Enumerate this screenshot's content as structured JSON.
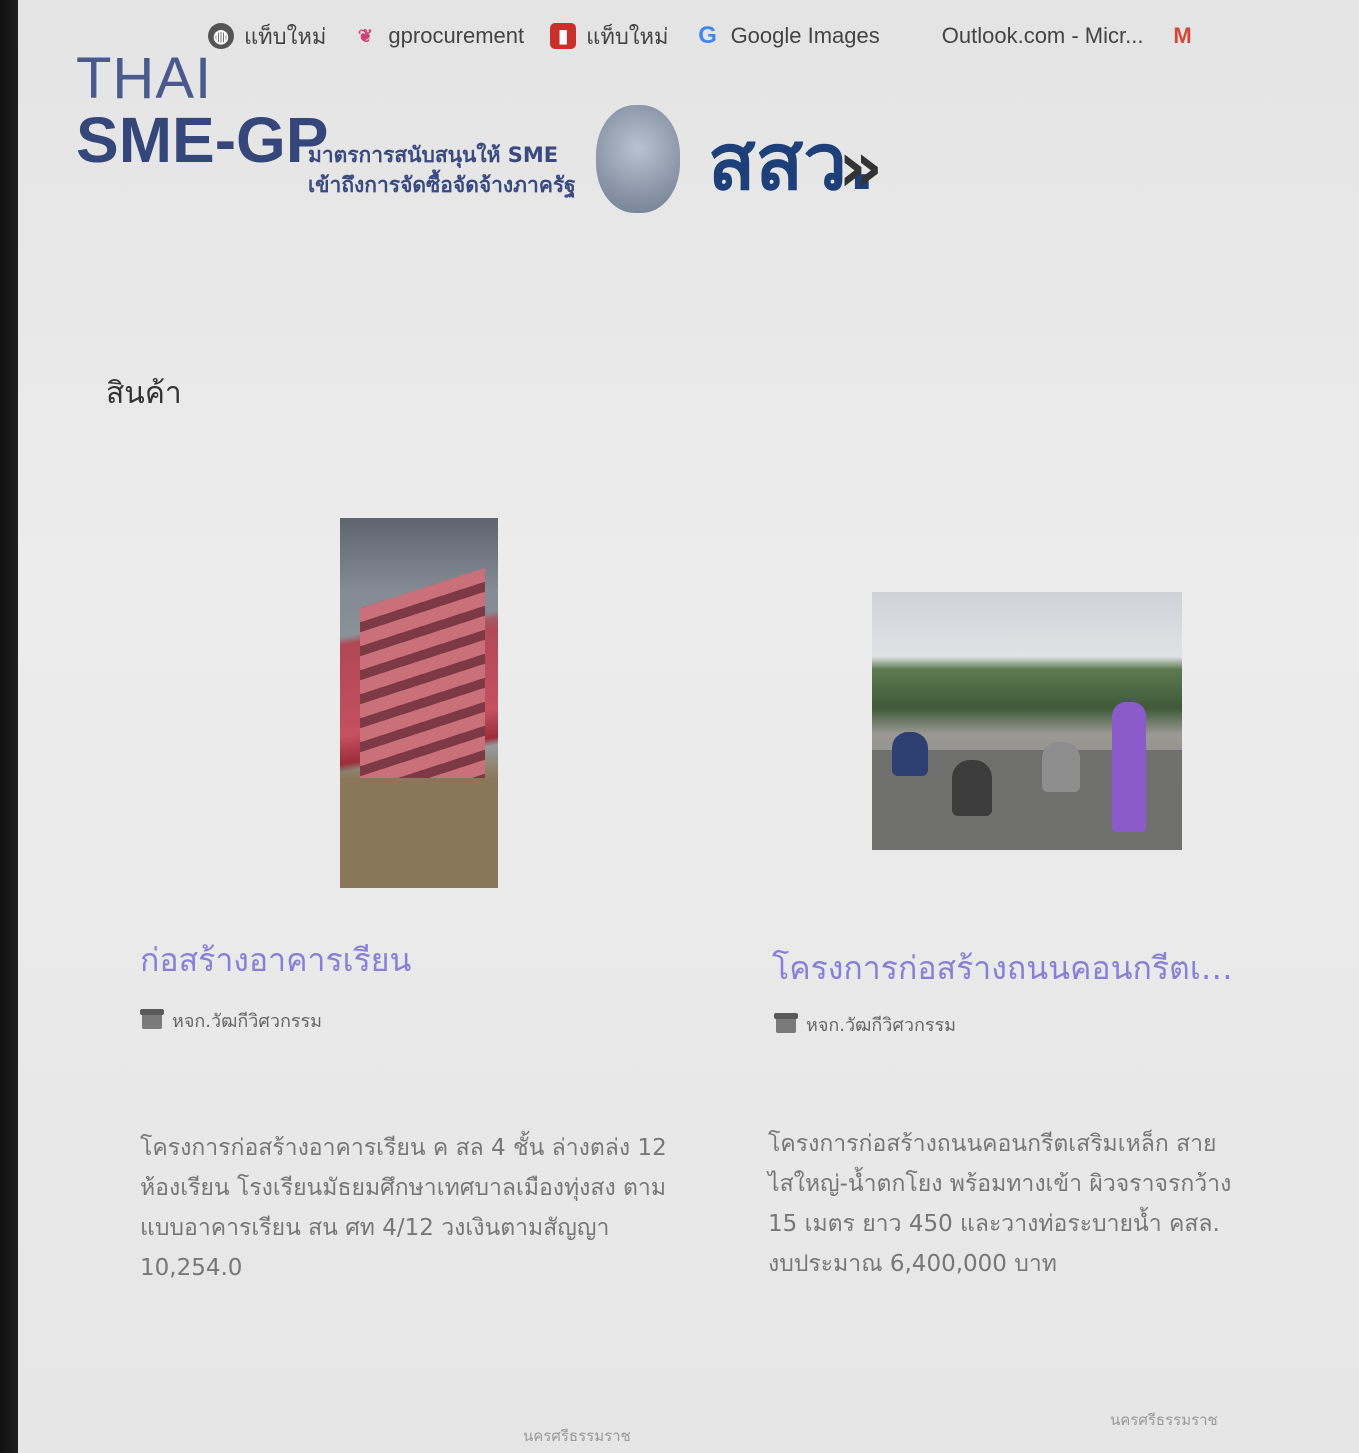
{
  "bookmarks": [
    {
      "label": "แท็บใหม่",
      "icon": "globe-icon"
    },
    {
      "label": "gprocurement",
      "icon": "gprocurement-icon"
    },
    {
      "label": "แท็บใหม่",
      "icon": "tab-icon"
    },
    {
      "label": "Google Images",
      "icon": "google-icon"
    },
    {
      "label": "Outlook.com - Micr...",
      "icon": "microsoft-icon"
    },
    {
      "label": "",
      "icon": "gmail-icon"
    }
  ],
  "header": {
    "logo_line1": "THAI",
    "logo_line2": "SME-GP",
    "tagline_line1": "มาตรการสนับสนุนให้ SME",
    "tagline_line2": "เข้าถึงการจัดซื้อจัดจ้างภาครัฐ",
    "agency_logo": "สสว."
  },
  "section": {
    "title": "สินค้า"
  },
  "products": [
    {
      "title": "ก่อสร้างอาคารเรียน",
      "seller": "หจก.วัฒกีวิศวกรรม",
      "description": "โครงการก่อสร้างอาคารเรียน ค สล 4 ชั้น ล่างตล่ง 12 ห้องเรียน โรงเรียนมัธยมศึกษาเทศบาลเมืองทุ่งสง ตามแบบอาคารเรียน สน ศท 4/12 วงเงินตามสัญญา 10,254.0",
      "location": "นครศรีธรรมราช"
    },
    {
      "title": "โครงการก่อสร้างถนนคอนกรีตเสริมเหล็...",
      "seller": "หจก.วัฒกีวิศวกรรม",
      "description": "โครงการก่อสร้างถนนคอนกรีตเสริมเหล็ก สายไสใหญ่-น้ำตกโยง พร้อมทางเข้า ผิวจราจรกว้าง 15 เมตร ยาว 450 และวางท่อระบายน้ำ คสล. งบประมาณ 6,400,000 บาท",
      "location": "นครศรีธรรมราช"
    }
  ]
}
